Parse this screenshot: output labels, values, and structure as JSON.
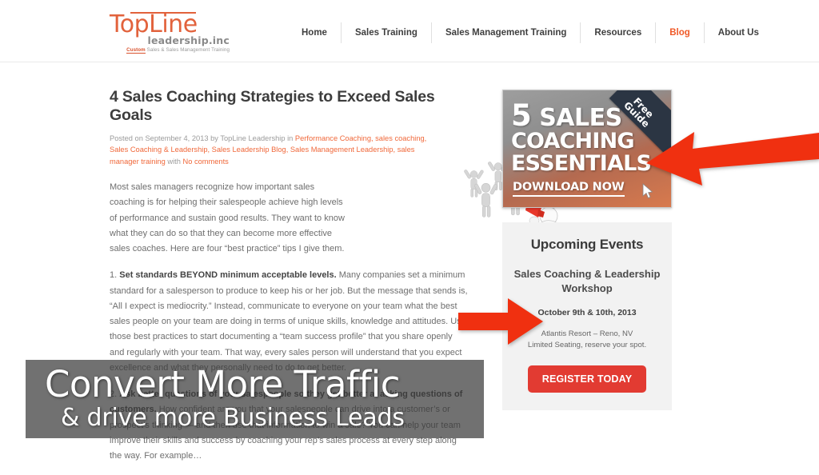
{
  "header": {
    "logo": {
      "line1": "TopLine",
      "line2": "leadership.inc",
      "tagline_accent": "Custom",
      "tagline_rest": " Sales & Sales Management Training"
    },
    "nav": [
      {
        "label": "Home",
        "active": false
      },
      {
        "label": "Sales Training",
        "active": false
      },
      {
        "label": "Sales Management Training",
        "active": false
      },
      {
        "label": "Resources",
        "active": false
      },
      {
        "label": "Blog",
        "active": true
      },
      {
        "label": "About Us",
        "active": false
      }
    ]
  },
  "post": {
    "title": "4 Sales Coaching Strategies to Exceed Sales Goals",
    "meta_prefix": "Posted on September 4, 2013 by TopLine Leadership in ",
    "meta_categories": "Performance Coaching, sales coaching, Sales Coaching & Leadership, Sales Leadership Blog, Sales Management Leadership, sales manager training",
    "meta_with": " with ",
    "meta_comments": "No comments",
    "paragraph_1": "Most sales managers recognize how important sales coaching is for helping their salespeople achieve high levels of performance and sustain good results. They want to know what they can do so that they can become more effective sales coaches. Here are four “best practice” tips I give them.",
    "heading_2_num": "1. ",
    "heading_2_bold": "Set standards BEYOND minimum acceptable levels.",
    "paragraph_2": "  Many companies set a minimum standard for a salesperson to produce to keep his or her job. But the message that sends is, “All I expect is mediocrity.” Instead, communicate to everyone on your team what the best sales people on your team are doing in terms of unique skills, knowledge and attitudes. Use those best practices to start documenting a “team success profile” that you share openly and regularly with your team. That way, every sales person will understand that you expect excellence and what they personally need to do to get better.",
    "heading_3_num": "2. ",
    "heading_3_bold": "Ask better questions of your salespeople so they get better at asking questions of customers.",
    "paragraph_3": " How confident are you that your salespeople can drive into a customer’s or prospect’s thinking — and then use that information to win a sale? You can help your team improve their skills and success by coaching your rep’s sales process at every step along the way. For example…",
    "image_alt": "3d-figures-cheering-megaphone"
  },
  "sidebar": {
    "promo": {
      "line1_number": "5",
      "line1_word": "SALES",
      "line2": "COACHING",
      "line3": "ESSENTIALS",
      "cta": "DOWNLOAD NOW",
      "ribbon_line1": "Free",
      "ribbon_line2": "Guide"
    },
    "events": {
      "title": "Upcoming Events",
      "subtitle": "Sales Coaching & Leadership Workshop",
      "date": "October 9th & 10th, 2013",
      "location_line1": "Atlantis Resort – Reno, NV",
      "location_line2": "Limited Seating, reserve your spot.",
      "button_label": "REGISTER TODAY"
    }
  },
  "overlay": {
    "line1": "Convert More Traffic",
    "line2": "& drive more Business Leads"
  },
  "annotations": {
    "arrow_top_name": "red-arrow-pointing-to-promo-banner",
    "arrow_mid_name": "red-arrow-pointing-to-events-box"
  },
  "colors": {
    "accent_orange": "#f05a28",
    "arrow_red": "#f03010",
    "button_red": "#e23b32",
    "ribbon_navy": "#2b3543"
  }
}
